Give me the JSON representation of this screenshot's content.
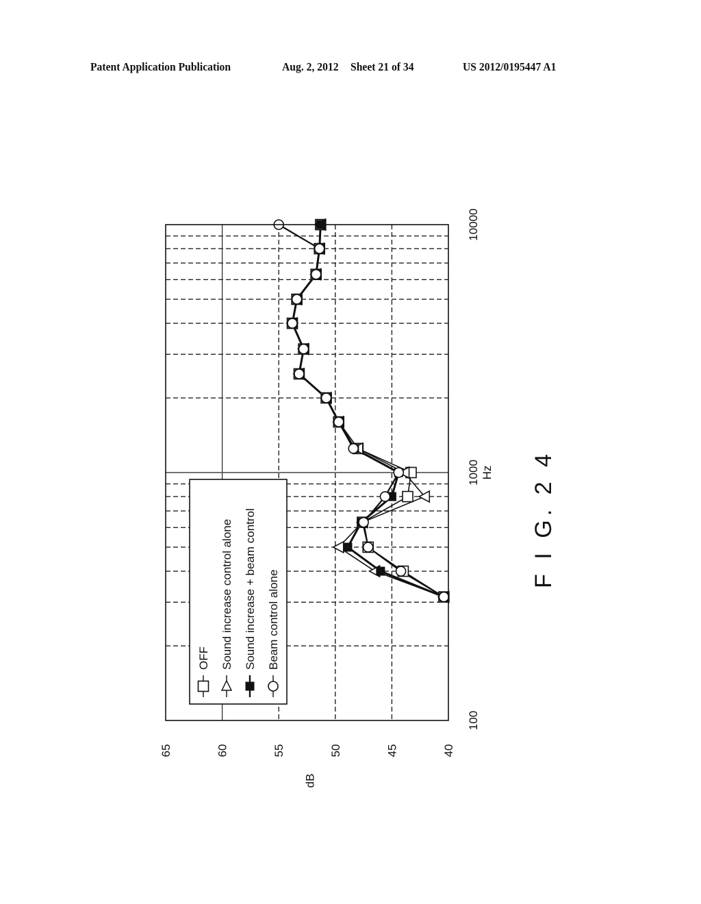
{
  "header": {
    "publication": "Patent Application Publication",
    "date": "Aug. 2, 2012",
    "sheet": "Sheet 21 of 34",
    "patent_number": "US 2012/0195447 A1"
  },
  "figure_label": "F I G. 2 4",
  "chart_data": {
    "type": "line",
    "orientation": "rotated-90-ccw",
    "title": "",
    "xlabel": "Hz",
    "ylabel": "dB",
    "xscale": "log",
    "xlim": [
      100,
      10000
    ],
    "ylim": [
      40,
      65
    ],
    "x_ticks": [
      100,
      1000,
      10000
    ],
    "x_tick_labels": [
      "100",
      "1000",
      "10000"
    ],
    "y_ticks": [
      40,
      45,
      50,
      55,
      60,
      65
    ],
    "y_tick_labels": [
      "40",
      "45",
      "50",
      "55",
      "60",
      "65"
    ],
    "grid": true,
    "legend_position": "top-left",
    "x": [
      315,
      400,
      500,
      630,
      800,
      1000,
      1250,
      1600,
      2000,
      2500,
      3150,
      4000,
      5000,
      6300,
      8000,
      10000
    ],
    "series": [
      {
        "name": "OFF",
        "marker": "open-square",
        "values": [
          40.4,
          44.0,
          47.1,
          47.6,
          43.6,
          43.3,
          48.0,
          49.7,
          50.8,
          53.2,
          52.8,
          53.8,
          53.4,
          51.7,
          51.4,
          51.3
        ]
      },
      {
        "name": "Sound increase control alone",
        "marker": "open-triangle",
        "values": [
          40.4,
          46.5,
          49.7,
          47.6,
          42.1,
          43.9,
          48.0,
          49.7,
          50.8,
          53.2,
          52.8,
          53.8,
          53.4,
          51.7,
          51.4,
          51.3
        ]
      },
      {
        "name": "Sound increase + beam control",
        "marker": "filled-square",
        "values": [
          40.4,
          46.0,
          48.9,
          47.7,
          45.0,
          44.4,
          48.3,
          49.7,
          50.8,
          53.2,
          52.8,
          53.8,
          53.4,
          51.7,
          51.4,
          51.3
        ]
      },
      {
        "name": "Beam control alone",
        "marker": "open-circle",
        "values": [
          40.4,
          44.2,
          47.1,
          47.5,
          45.6,
          44.4,
          48.4,
          49.7,
          50.8,
          53.2,
          52.8,
          53.8,
          53.4,
          51.7,
          51.4,
          55.0
        ]
      }
    ]
  }
}
